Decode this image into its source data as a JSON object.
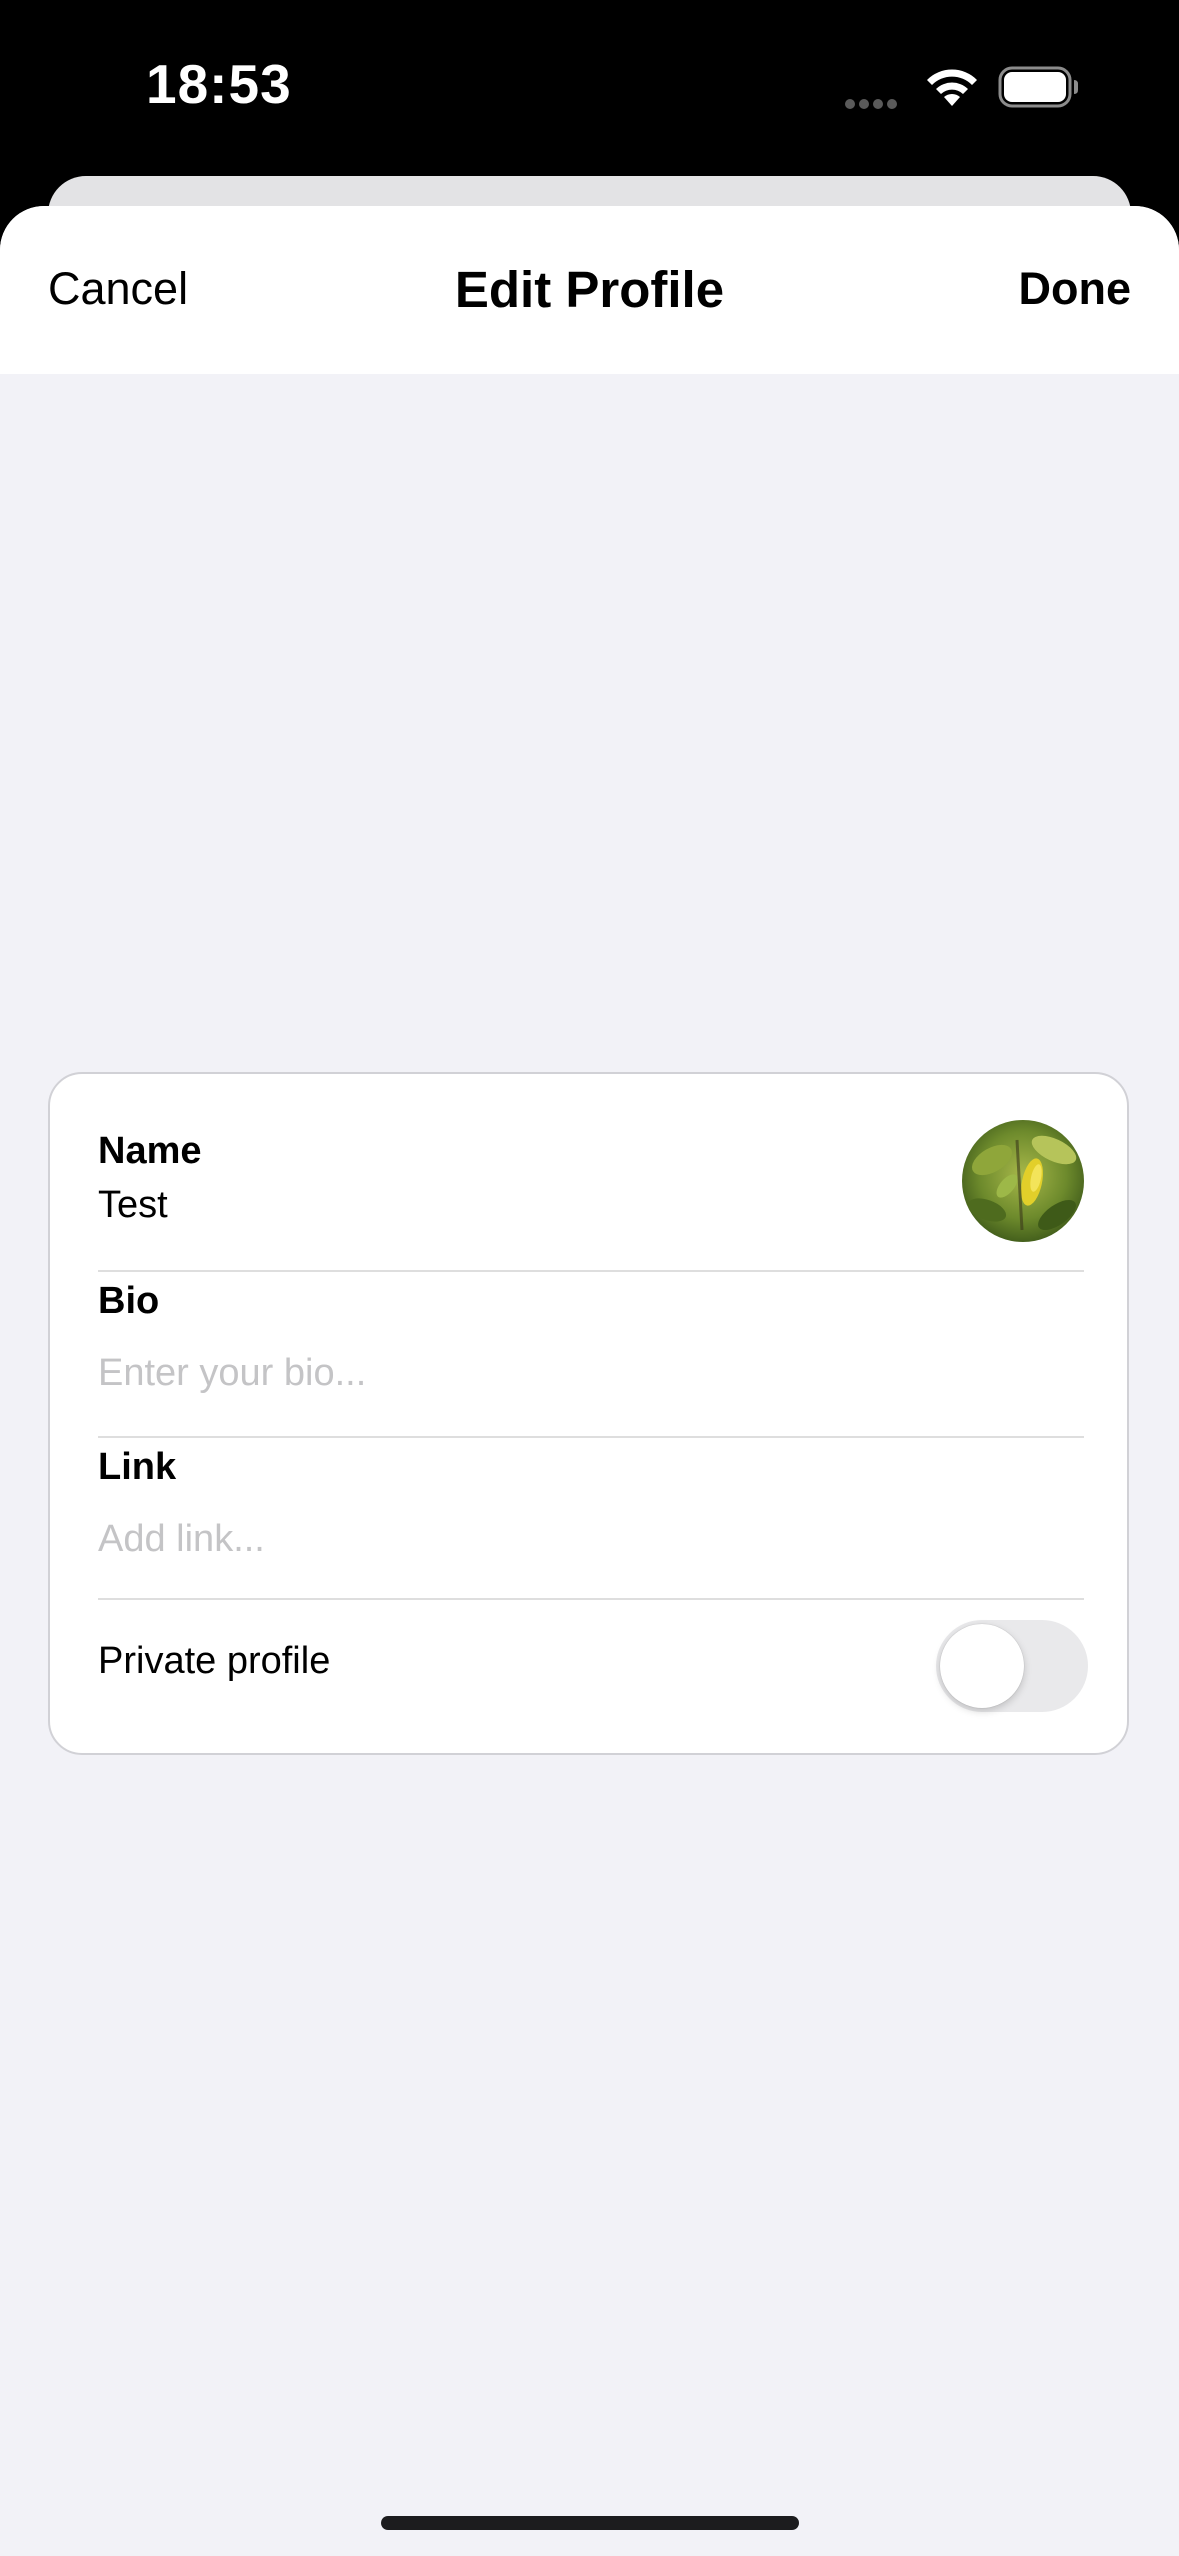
{
  "status_bar": {
    "time": "18:53",
    "icons": [
      "cellular-dots-icon",
      "wifi-icon",
      "battery-icon"
    ]
  },
  "nav": {
    "cancel_label": "Cancel",
    "title": "Edit Profile",
    "done_label": "Done"
  },
  "profile": {
    "name_label": "Name",
    "name_value": "Test",
    "bio_label": "Bio",
    "bio_placeholder": "Enter your bio...",
    "link_label": "Link",
    "link_placeholder": "Add link...",
    "private_label": "Private profile",
    "private_enabled": false,
    "avatar_icon": "profile-photo"
  },
  "colors": {
    "sheet_background": "#f2f2f7",
    "card_background": "#ffffff",
    "placeholder": "#c4c4c6",
    "toggle_off": "#e9e9eb"
  }
}
